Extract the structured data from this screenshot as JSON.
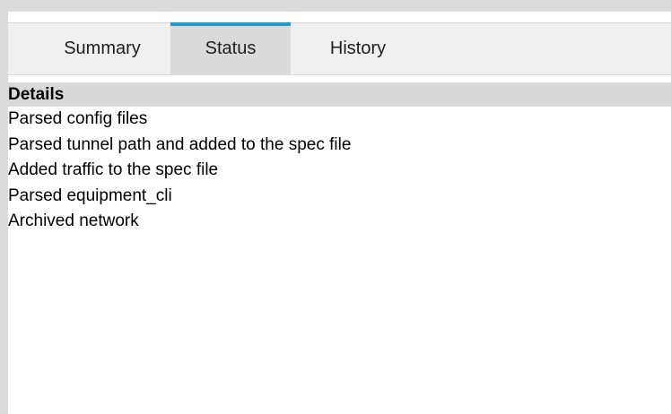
{
  "tabs": [
    {
      "label": "Summary",
      "active": false
    },
    {
      "label": "Status",
      "active": true
    },
    {
      "label": "History",
      "active": false
    }
  ],
  "accent_color": "#1e9bd7",
  "details": {
    "header": "Details",
    "items": [
      "Parsed config files",
      "Parsed tunnel path and added to the spec file",
      "Added traffic to the spec file",
      "Parsed equipment_cli",
      "Archived network"
    ]
  }
}
